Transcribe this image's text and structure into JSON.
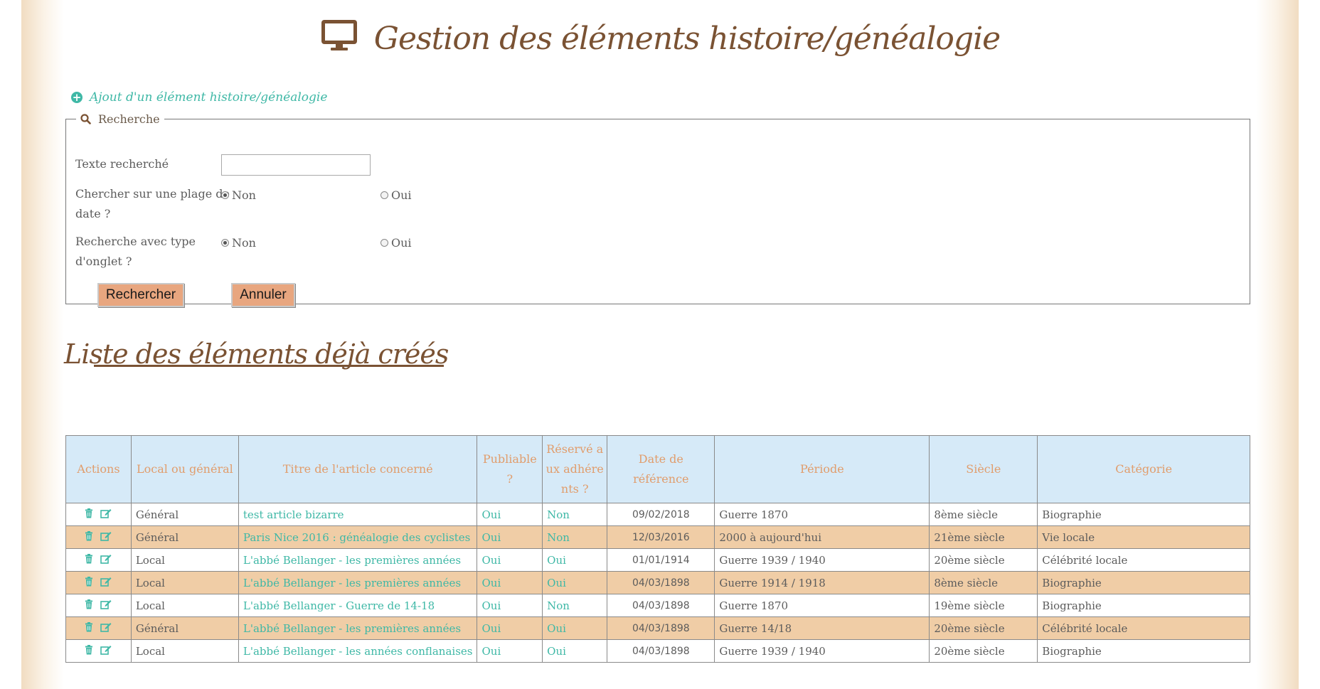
{
  "header": {
    "title": "Gestion des éléments histoire/généalogie",
    "title_icon": "desktop-monitor-icon"
  },
  "add_link": {
    "label": "Ajout d'un élément histoire/généalogie",
    "icon": "plus-circle-icon"
  },
  "search": {
    "legend": "Recherche",
    "legend_icon": "search-icon",
    "text_label": "Texte recherché",
    "text_value": "",
    "date_range_label_line1": "Chercher sur une plage de",
    "date_range_label_line2": "date ?",
    "tab_type_label_line1": "Recherche avec type",
    "tab_type_label_line2": "d'onglet ?",
    "option_no": "Non",
    "option_yes": "Oui",
    "date_range_selected": "Non",
    "tab_type_selected": "Non",
    "submit_label": "Rechercher",
    "cancel_label": "Annuler"
  },
  "list": {
    "title": "Liste des éléments déjà créés",
    "columns": [
      "Actions",
      "Local ou général",
      "Titre de l'article concerné",
      "Publiable ?",
      "Réservé a ux adhére nts ?",
      "Date de référence",
      "Période",
      "Siècle",
      "Catégorie"
    ],
    "rows": [
      {
        "scope": "Général",
        "title": "test article bizarre",
        "publishable": "Oui",
        "reserved": "Non",
        "date": "09/02/2018",
        "period": "Guerre 1870",
        "century": "8ème siècle",
        "category": "Biographie"
      },
      {
        "scope": "Général",
        "title": "Paris Nice 2016 : généalogie des cyclistes",
        "publishable": "Oui",
        "reserved": "Non",
        "date": "12/03/2016",
        "period": "2000 à aujourd'hui",
        "century": "21ème siècle",
        "category": "Vie locale"
      },
      {
        "scope": "Local",
        "title": "L'abbé Bellanger - les premières années",
        "publishable": "Oui",
        "reserved": "Oui",
        "date": "01/01/1914",
        "period": "Guerre 1939 / 1940",
        "century": "20ème siècle",
        "category": "Célébrité locale"
      },
      {
        "scope": "Local",
        "title": "L'abbé Bellanger - les premières années",
        "publishable": "Oui",
        "reserved": "Oui",
        "date": "04/03/1898",
        "period": "Guerre 1914 / 1918",
        "century": "8ème siècle",
        "category": "Biographie"
      },
      {
        "scope": "Local",
        "title": "L'abbé Bellanger - Guerre de 14-18",
        "publishable": "Oui",
        "reserved": "Non",
        "date": "04/03/1898",
        "period": "Guerre 1870",
        "century": "19ème siècle",
        "category": "Biographie"
      },
      {
        "scope": "Général",
        "title": "L'abbé Bellanger - les premières années",
        "publishable": "Oui",
        "reserved": "Oui",
        "date": "04/03/1898",
        "period": "Guerre 14/18",
        "century": "20ème siècle",
        "category": "Célébrité locale"
      },
      {
        "scope": "Local",
        "title": "L'abbé Bellanger - les années conflanaises",
        "publishable": "Oui",
        "reserved": "Oui",
        "date": "04/03/1898",
        "period": "Guerre 1939 / 1940",
        "century": "20ème siècle",
        "category": "Biographie"
      }
    ],
    "row_actions": [
      "trash-icon",
      "edit-icon"
    ]
  },
  "colors": {
    "brand_brown": "#7a5233",
    "link_teal": "#3fb8a6",
    "header_blue": "#d6eaf8",
    "header_text": "#e19d6c",
    "alt_row": "#f0cda6",
    "button": "#e8a67f"
  }
}
